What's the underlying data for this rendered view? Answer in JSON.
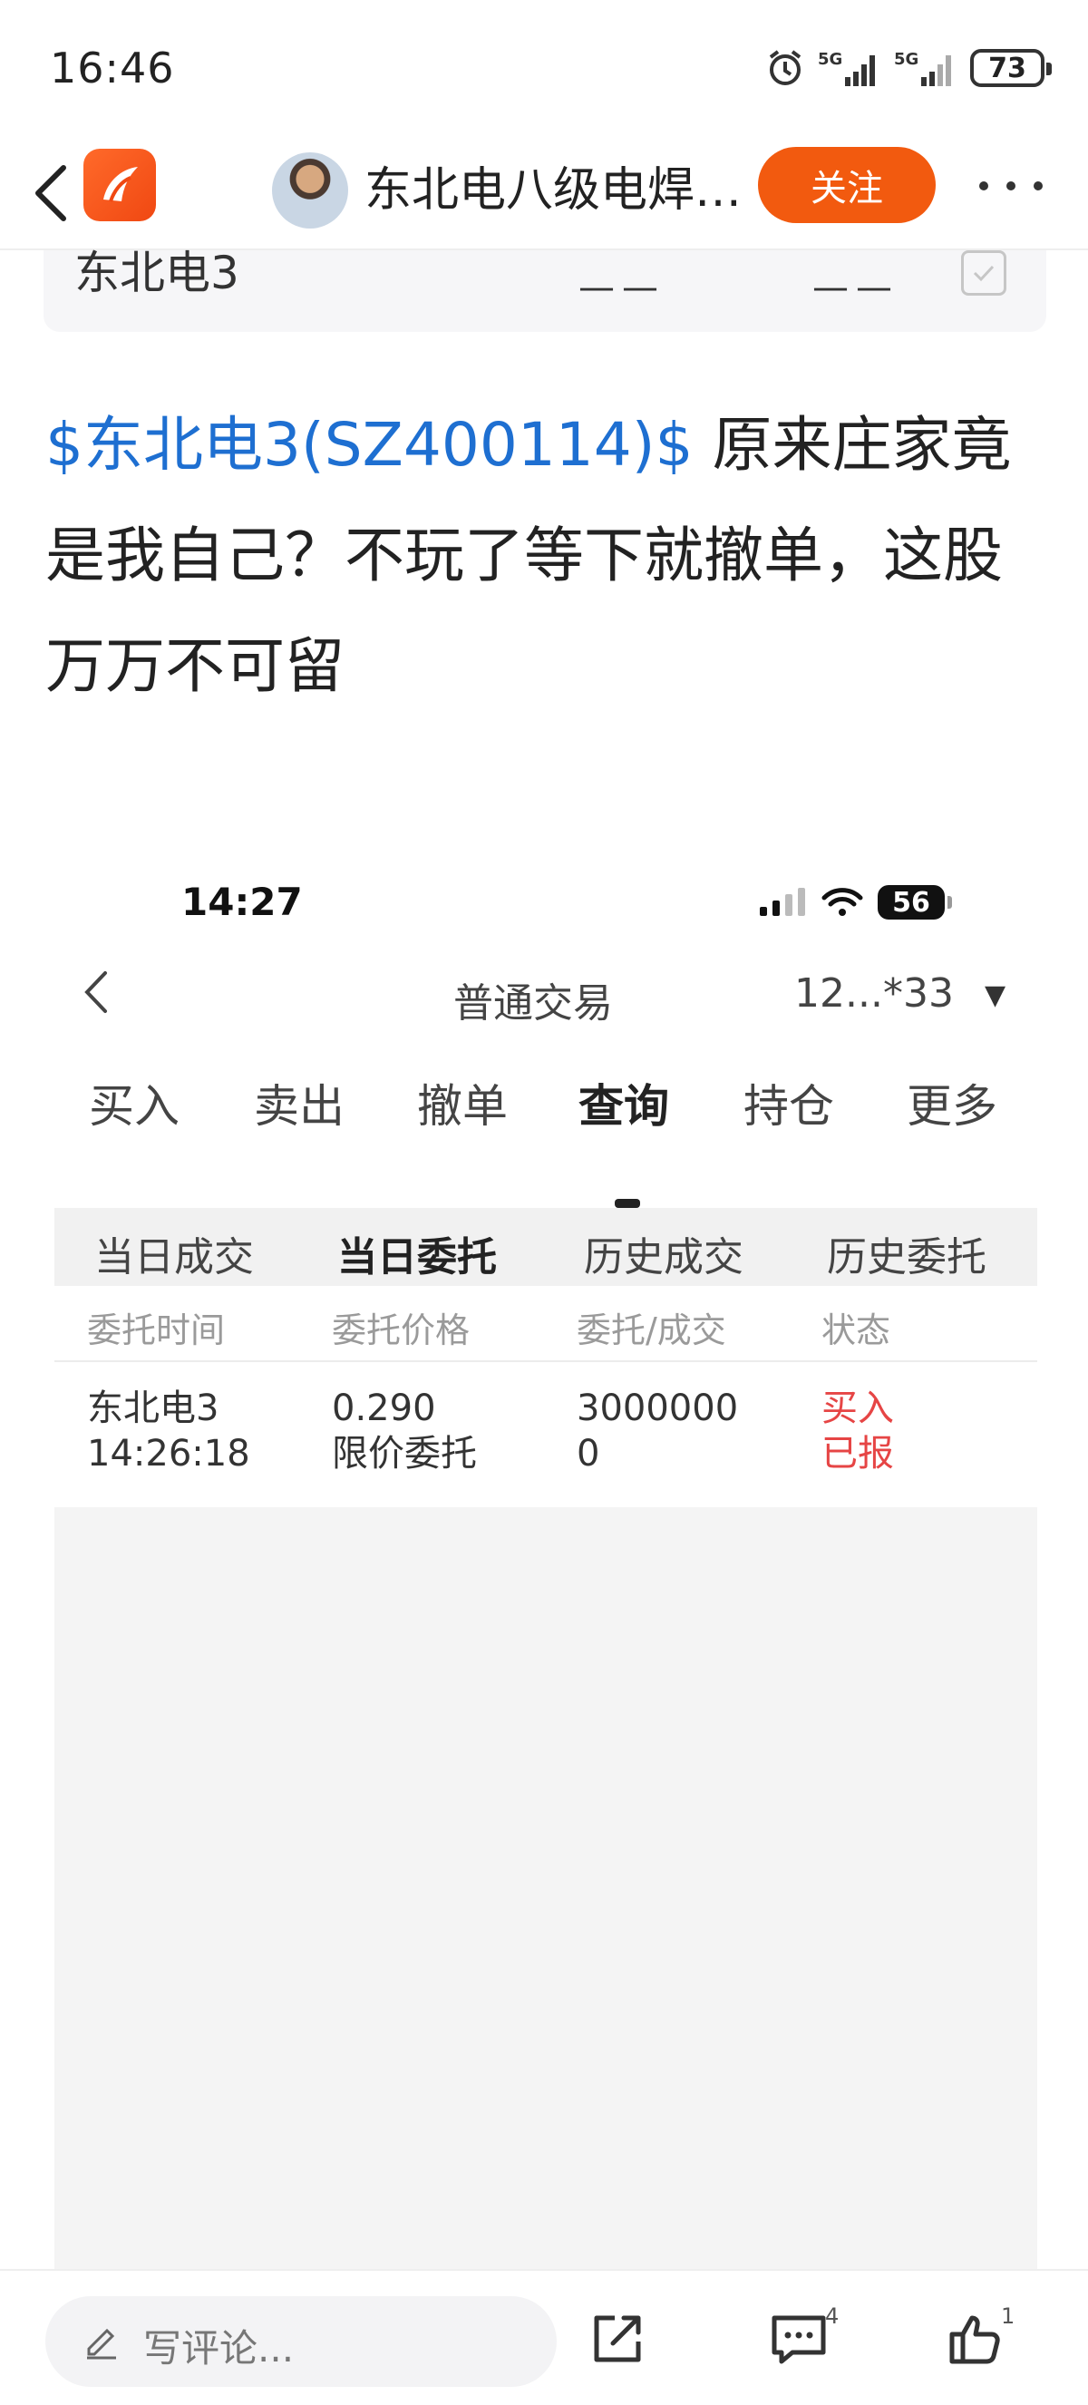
{
  "status_bar": {
    "time": "16:46",
    "signal1": "5G",
    "signal2": "5G",
    "battery": "73"
  },
  "nav": {
    "title": "东北电八级电焊…",
    "follow_label": "关注"
  },
  "stock_card": {
    "name": "东北电3",
    "value1": "——",
    "value2": "——"
  },
  "post": {
    "link_text": "$东北电3(SZ400114)$",
    "body_text": " 原来庄家竟是我自己？不玩了等下就撤单，这股万万不可留"
  },
  "inner": {
    "time": "14:27",
    "battery": "56",
    "title": "普通交易",
    "account": "12...*33",
    "tabs": [
      "买入",
      "卖出",
      "撤单",
      "查询",
      "持仓",
      "更多"
    ],
    "active_tab": "查询",
    "subtabs": [
      "当日成交",
      "当日委托",
      "历史成交",
      "历史委托"
    ],
    "active_subtab": "当日委托",
    "headers": [
      "委托时间",
      "委托价格",
      "委托/成交",
      "状态"
    ],
    "row": {
      "name": "东北电3",
      "time": "14:26:18",
      "price": "0.290",
      "price_type": "限价委托",
      "quantity": "3000000",
      "filled": "0",
      "side": "买入",
      "status": "已报"
    }
  },
  "bottom": {
    "comment_placeholder": "写评论...",
    "comment_count": "4",
    "like_count": "1"
  },
  "colors": {
    "accent": "#f25a0f",
    "link": "#1e6fd1",
    "buy_red": "#e64545"
  }
}
